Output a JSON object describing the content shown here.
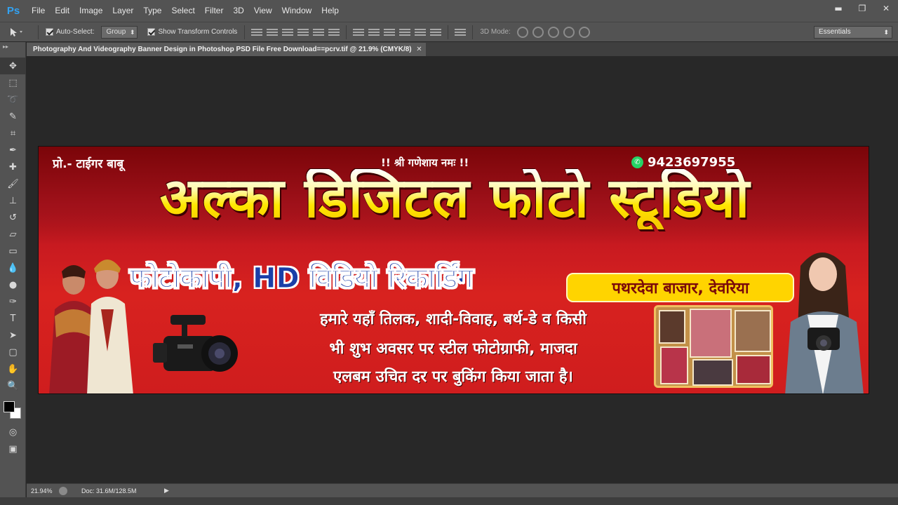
{
  "app": {
    "logo": "Ps"
  },
  "menu": [
    "File",
    "Edit",
    "Image",
    "Layer",
    "Type",
    "Select",
    "Filter",
    "3D",
    "View",
    "Window",
    "Help"
  ],
  "window_controls": {
    "minimize": "▬",
    "restore": "❐",
    "close": "✕"
  },
  "options": {
    "auto_select_label": "Auto-Select:",
    "auto_select_value": "Group",
    "show_transform_label": "Show Transform Controls",
    "mode_3d_label": "3D Mode:",
    "workspace": "Essentials"
  },
  "document": {
    "tab_title": "Photography And Videography Banner Design in Photoshop PSD File Free Download==pcrv.tif @ 21.9% (CMYK/8)",
    "close": "✕"
  },
  "banner": {
    "proprietor": "प्रो.- टाईगर बाबू",
    "invocation": "!! श्री गणेशाय नमः !!",
    "phone": "9423697955",
    "studio_name": "अल्का डिजिटल फोटो स्टूडियो",
    "services": "फोटोकापी, HD विडियो रिकार्डिंग",
    "location": "पथरदेवा बाजार, देवरिया",
    "desc_line1": "हमारे यहाँ तिलक, शादी-विवाह, बर्थ-डे व किसी",
    "desc_line2": "भी शुभ अवसर पर स्टील फोटोग्राफी, माजदा",
    "desc_line3": "एलबम उचित दर पर बुकिंग किया जाता है।"
  },
  "status": {
    "zoom": "21.94%",
    "doc_size": "Doc: 31.6M/128.5M",
    "arrow": "▶"
  },
  "tools": [
    "move-tool-icon",
    "marquee-icon",
    "lasso-icon",
    "quick-select-icon",
    "crop-icon",
    "eyedropper-icon",
    "healing-icon",
    "brush-icon",
    "stamp-icon",
    "history-brush-icon",
    "eraser-icon",
    "gradient-icon",
    "blur-icon",
    "dodge-icon",
    "pen-icon",
    "type-icon",
    "path-select-icon",
    "shape-icon",
    "hand-icon",
    "zoom-icon"
  ]
}
